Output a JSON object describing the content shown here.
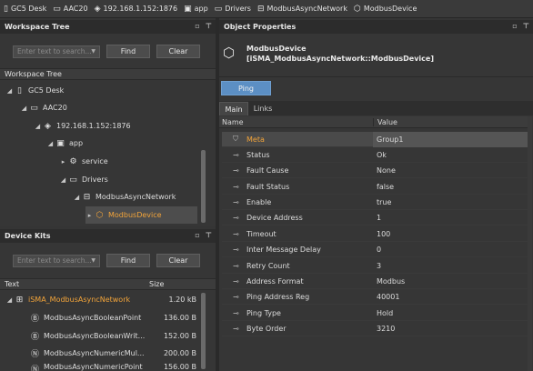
{
  "breadcrumb": [
    {
      "label": "GC5 Desk",
      "icon": "document-icon"
    },
    {
      "label": "AAC20",
      "icon": "folder-icon"
    },
    {
      "label": "192.168.1.152:1876",
      "icon": "station-icon"
    },
    {
      "label": "app",
      "icon": "app-icon"
    },
    {
      "label": "Drivers",
      "icon": "folder-icon"
    },
    {
      "label": "ModbusAsyncNetwork",
      "icon": "network-icon"
    },
    {
      "label": "ModbusDevice",
      "icon": "device-icon"
    }
  ],
  "workspace": {
    "title": "Workspace Tree",
    "search_placeholder": "Enter text to search...",
    "find": "Find",
    "clear": "Clear",
    "column": "Workspace Tree",
    "items": [
      {
        "label": "GC5 Desk"
      },
      {
        "label": "AAC20"
      },
      {
        "label": "192.168.1.152:1876"
      },
      {
        "label": "app"
      },
      {
        "label": "service"
      },
      {
        "label": "Drivers"
      },
      {
        "label": "ModbusAsyncNetwork"
      },
      {
        "label": "ModbusDevice"
      }
    ]
  },
  "kits": {
    "title": "Device Kits",
    "search_placeholder": "Enter text to search...",
    "find": "Find",
    "clear": "Clear",
    "col_text": "Text",
    "col_size": "Size",
    "items": [
      {
        "label": "iSMA_ModbusAsyncNetwork",
        "size": "1.20 kB",
        "badge": ""
      },
      {
        "label": "ModbusAsyncBooleanPoint",
        "size": "136.00 B",
        "badge": "B"
      },
      {
        "label": "ModbusAsyncBooleanWrit...",
        "size": "152.00 B",
        "badge": "B"
      },
      {
        "label": "ModbusAsyncNumericMul...",
        "size": "200.00 B",
        "badge": "N"
      },
      {
        "label": "ModbusAsyncNumericPoint",
        "size": "156.00 B",
        "badge": "N"
      }
    ]
  },
  "props": {
    "title": "Object Properties",
    "object_name": "ModbusDevice",
    "object_type": "[iSMA_ModbusAsyncNetwork::ModbusDevice]",
    "action": "Ping",
    "tabs": [
      "Main",
      "Links"
    ],
    "col_name": "Name",
    "col_value": "Value",
    "rows": [
      {
        "name": "Meta",
        "value": "Group1"
      },
      {
        "name": "Status",
        "value": "Ok"
      },
      {
        "name": "Fault Cause",
        "value": "None"
      },
      {
        "name": "Fault Status",
        "value": "false"
      },
      {
        "name": "Enable",
        "value": "true"
      },
      {
        "name": "Device Address",
        "value": "1"
      },
      {
        "name": "Timeout",
        "value": "100"
      },
      {
        "name": "Inter Message Delay",
        "value": "0"
      },
      {
        "name": "Retry Count",
        "value": "3"
      },
      {
        "name": "Address Format",
        "value": "Modbus"
      },
      {
        "name": "Ping Address Reg",
        "value": "40001"
      },
      {
        "name": "Ping Type",
        "value": "Hold"
      },
      {
        "name": "Byte Order",
        "value": "3210"
      }
    ]
  },
  "colors": {
    "accent": "#f2a43a",
    "ping_button": "#5c8fc4"
  }
}
